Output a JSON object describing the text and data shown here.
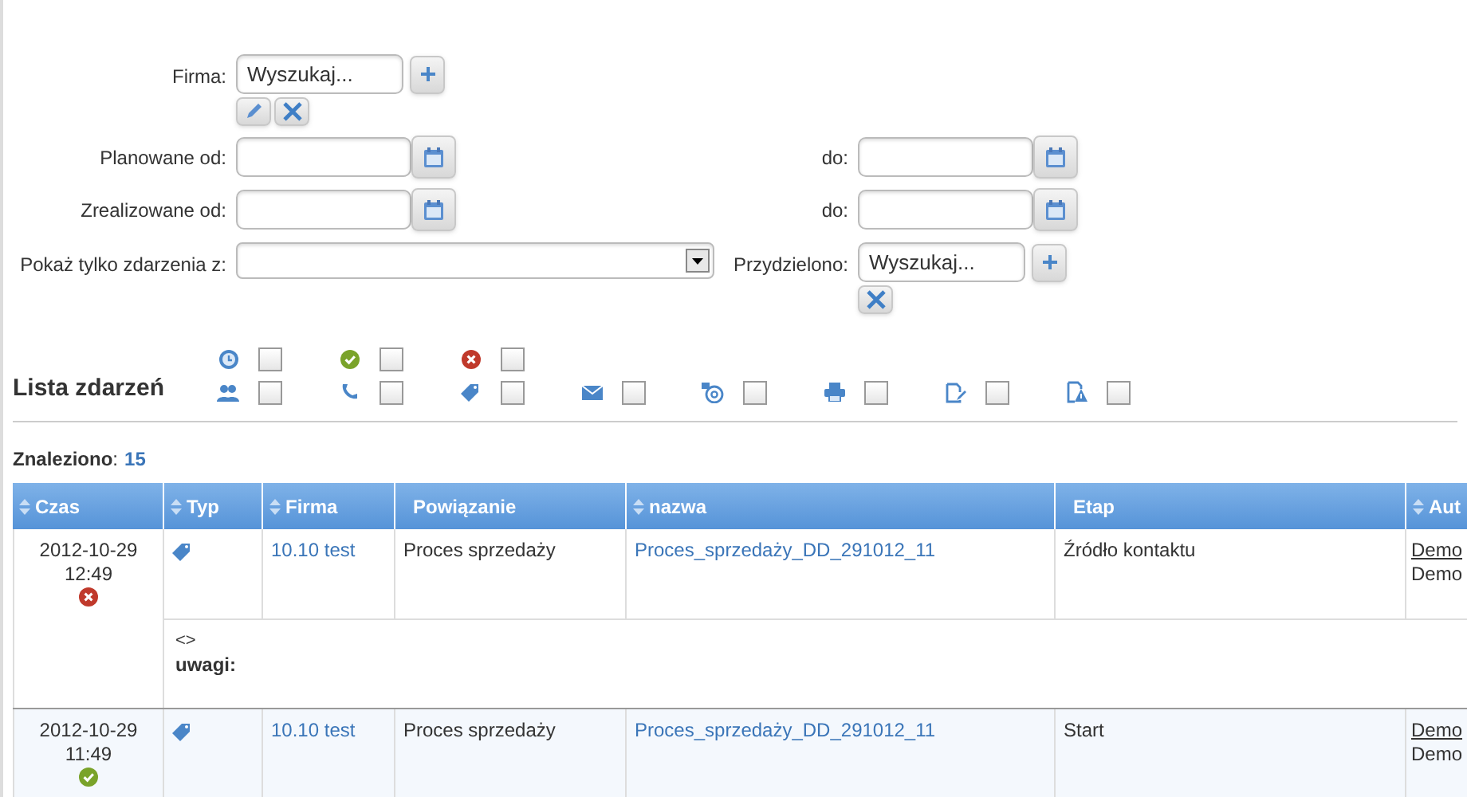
{
  "form": {
    "firma": {
      "label": "Firma:",
      "placeholder": "Wyszukaj..."
    },
    "planned": {
      "label": "Planowane od:",
      "to_label": "do:"
    },
    "done": {
      "label": "Zrealizowane od:",
      "to_label": "do:"
    },
    "show_only": {
      "label": "Pokaż tylko zdarzenia z:"
    },
    "assigned": {
      "label": "Przydzielono:",
      "placeholder": "Wyszukaj..."
    }
  },
  "list_title": "Lista zdarzeń",
  "filters_top": [
    {
      "kind": "scheduled",
      "checked": false
    },
    {
      "kind": "done",
      "checked": false
    },
    {
      "kind": "error",
      "checked": false
    }
  ],
  "filters_bottom": [
    {
      "kind": "meeting",
      "checked": false
    },
    {
      "kind": "call",
      "checked": false
    },
    {
      "kind": "tag",
      "checked": false
    },
    {
      "kind": "mail",
      "checked": false
    },
    {
      "kind": "email",
      "checked": false
    },
    {
      "kind": "print",
      "checked": false
    },
    {
      "kind": "edit",
      "checked": false
    },
    {
      "kind": "warning",
      "checked": false
    }
  ],
  "found": {
    "label": "Znaleziono",
    "separator": ":",
    "count": "15"
  },
  "table": {
    "columns": [
      {
        "label": "Czas",
        "sortable": true
      },
      {
        "label": "Typ",
        "sortable": true
      },
      {
        "label": "Firma",
        "sortable": true
      },
      {
        "label": "Powiązanie",
        "sortable": false
      },
      {
        "label": "nazwa",
        "sortable": true
      },
      {
        "label": "Etap",
        "sortable": false
      },
      {
        "label": "Aut",
        "sortable": true
      }
    ],
    "rows": [
      {
        "date": "2012-10-29",
        "time": "12:49",
        "failed": true,
        "firma": "10.10 test",
        "relation": "Proces sprzedaży",
        "name": "Proces_sprzedaży_DD_291012_11",
        "stage": "Źródło kontaktu",
        "author": "Demo",
        "author_2": "Demo",
        "note": {
          "line": "<>",
          "label": "uwagi:"
        }
      },
      {
        "date": "2012-10-29",
        "time": "11:49",
        "failed": false,
        "firma": "10.10 test",
        "relation": "Proces sprzedaży",
        "name": "Proces_sprzedaży_DD_291012_11",
        "stage": "Start",
        "author": "Demo",
        "author_2": "Demo"
      }
    ]
  }
}
